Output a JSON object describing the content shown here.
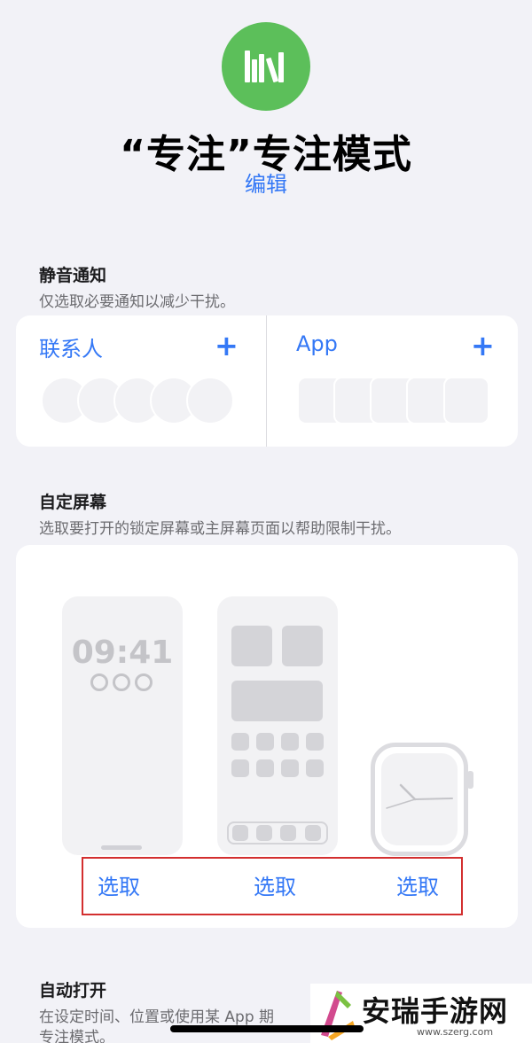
{
  "header": {
    "title": "“专注”专注模式",
    "edit_label": "编辑",
    "icon": "books-icon",
    "accent": "#5cbf5a"
  },
  "silence": {
    "title": "静音通知",
    "subtitle": "仅选取必要通知以减少干扰。",
    "people_label": "联系人",
    "apps_label": "App",
    "add_symbol": "+"
  },
  "screens": {
    "title": "自定屏幕",
    "subtitle": "选取要打开的锁定屏幕或主屏幕页面以帮助限制干扰。",
    "lock_time": "09:41",
    "choose_lock": "选取",
    "choose_home": "选取",
    "choose_watch": "选取"
  },
  "auto": {
    "title": "自动打开",
    "subtitle_line1": "在设定时间、位置或使用某 App 期",
    "subtitle_line2": "专注模式。"
  },
  "watermark": {
    "name": "安瑞手游网",
    "url": "www.szerg.com"
  },
  "colors": {
    "link": "#3478f6",
    "highlight": "#d32f2f"
  }
}
